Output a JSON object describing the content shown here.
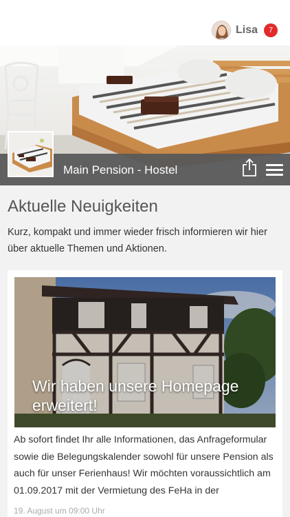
{
  "header": {
    "username": "Lisa",
    "notification_count": "7",
    "avatar_icon": "user-avatar"
  },
  "hero": {
    "title": "Main Pension - Hostel",
    "share_icon": "share-icon",
    "menu_icon": "hamburger-menu-icon"
  },
  "news": {
    "section_title": "Aktuelle Neuigkeiten",
    "intro": "Kurz, kompakt und immer wieder frisch informieren wir hier über aktuelle Themen und Aktionen.",
    "items": [
      {
        "headline": "Wir haben unsere Homepage erweitert!",
        "text": "Ab sofort findet Ihr alle Informationen, das Anfrageformular sowie die Belegungskalender sowohl für unsere Pension als auch für unser Ferienhaus! Wir möchten voraussichtlich am 01.09.2017 mit der Vermietung des FeHa in der",
        "date": "19. August um 09:00 Uhr"
      }
    ]
  },
  "colors": {
    "badge": "#e22a2a",
    "hero_bar": "#5a5a5a",
    "background": "#f2f2f2"
  }
}
